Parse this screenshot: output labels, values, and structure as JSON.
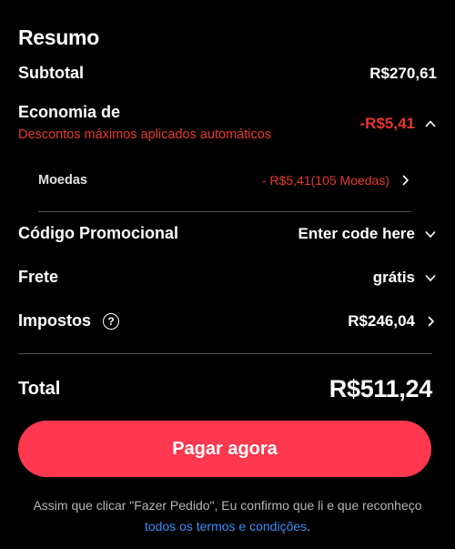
{
  "summary": {
    "title": "Resumo",
    "subtotal": {
      "label": "Subtotal",
      "value": "R$270,61"
    },
    "savings": {
      "label": "Economia de",
      "subtitle": "Descontos máximos aplicados automáticos",
      "value": "-R$5,41",
      "expanded": true,
      "coins": {
        "label": "Moedas",
        "value": "- R$5,41(105 Moedas)"
      }
    },
    "promo": {
      "label": "Código Promocional",
      "value": "Enter code here"
    },
    "shipping": {
      "label": "Frete",
      "value": "grátis"
    },
    "taxes": {
      "label": "Impostos",
      "help_icon_glyph": "?",
      "value": "R$246,04"
    },
    "total": {
      "label": "Total",
      "value": "R$511,24"
    }
  },
  "pay_button": {
    "label": "Pagar agora"
  },
  "disclaimer": {
    "text_line": "Assim que clicar \"Fazer Pedido\", Eu confirmo que li e que reconheço ",
    "link_text": "todos os termos e condições",
    "trailing": "."
  },
  "colors": {
    "background": "#000000",
    "accent_red": "#e8372e",
    "button": "#fd384f",
    "link": "#3e8ef7"
  },
  "icons": {
    "collapse": "chevron-up-icon",
    "navigate": "chevron-right-icon",
    "dropdown": "chevron-down-icon",
    "help": "question-circle-icon"
  }
}
